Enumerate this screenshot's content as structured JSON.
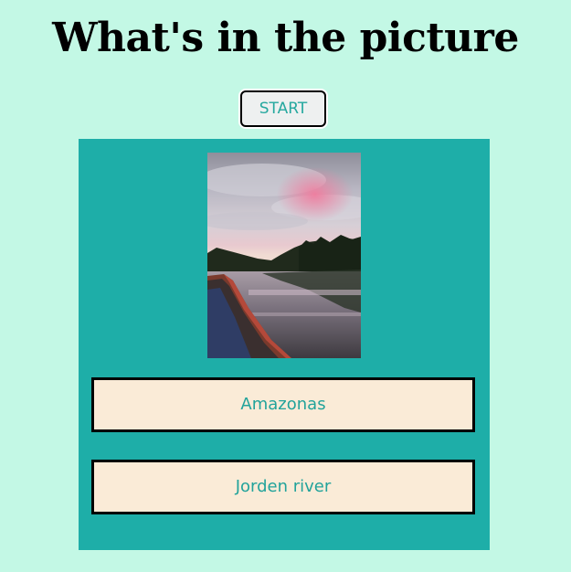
{
  "header": {
    "title": "What's in the picture"
  },
  "controls": {
    "start_label": "START"
  },
  "quiz": {
    "image": "photo of a river at sunset from a boat",
    "answers": [
      {
        "label": "Amazonas"
      },
      {
        "label": "Jorden river"
      }
    ]
  },
  "colors": {
    "page_background": "#c3f8e5",
    "panel_background": "#1eaea8",
    "answer_background": "#faebd7",
    "accent_text": "#22a39b"
  }
}
